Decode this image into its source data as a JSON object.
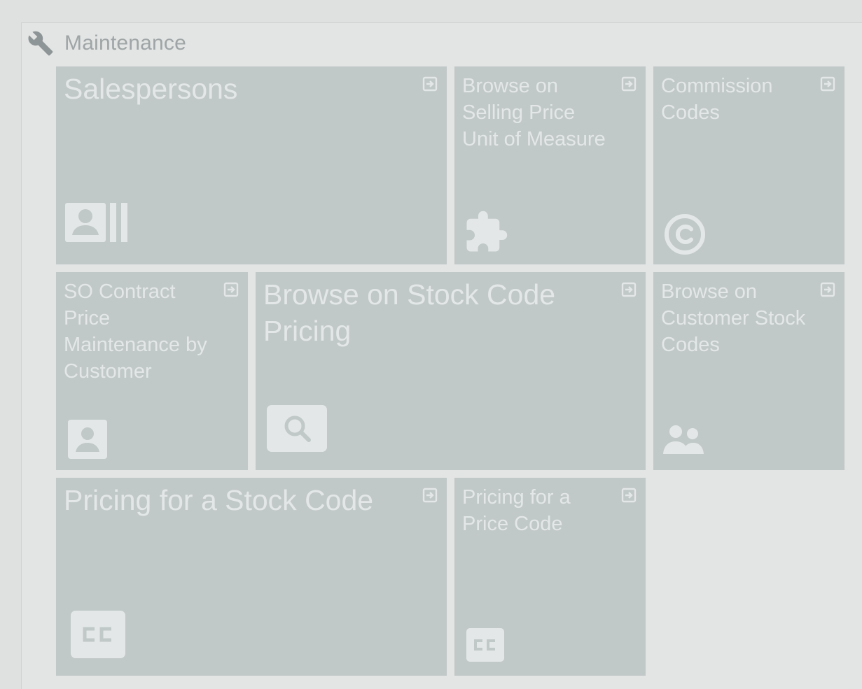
{
  "section": {
    "title": "Maintenance",
    "icon": "wrench-icon"
  },
  "colors": {
    "page_bg": "#dfe1e0",
    "tile_bg": "#c1c8c8",
    "tile_text": "#e3e7e7",
    "header_text": "#9fa5a6"
  },
  "tiles": [
    {
      "label": "Salespersons",
      "icon": "contact-card-icon"
    },
    {
      "label": "Browse on Selling Price Unit of Measure",
      "icon": "puzzle-piece-icon"
    },
    {
      "label": "Commission Codes",
      "icon": "copyright-icon"
    },
    {
      "label": "SO Contract Price Maintenance by Customer",
      "icon": "person-badge-icon"
    },
    {
      "label": "Browse on Stock Code Pricing",
      "icon": "search-icon"
    },
    {
      "label": "Browse on Customer Stock Codes",
      "icon": "people-icon"
    },
    {
      "label": "Pricing for a Stock Code",
      "icon": "cc-icon"
    },
    {
      "label": "Pricing for a Price Code",
      "icon": "cc-icon"
    }
  ]
}
